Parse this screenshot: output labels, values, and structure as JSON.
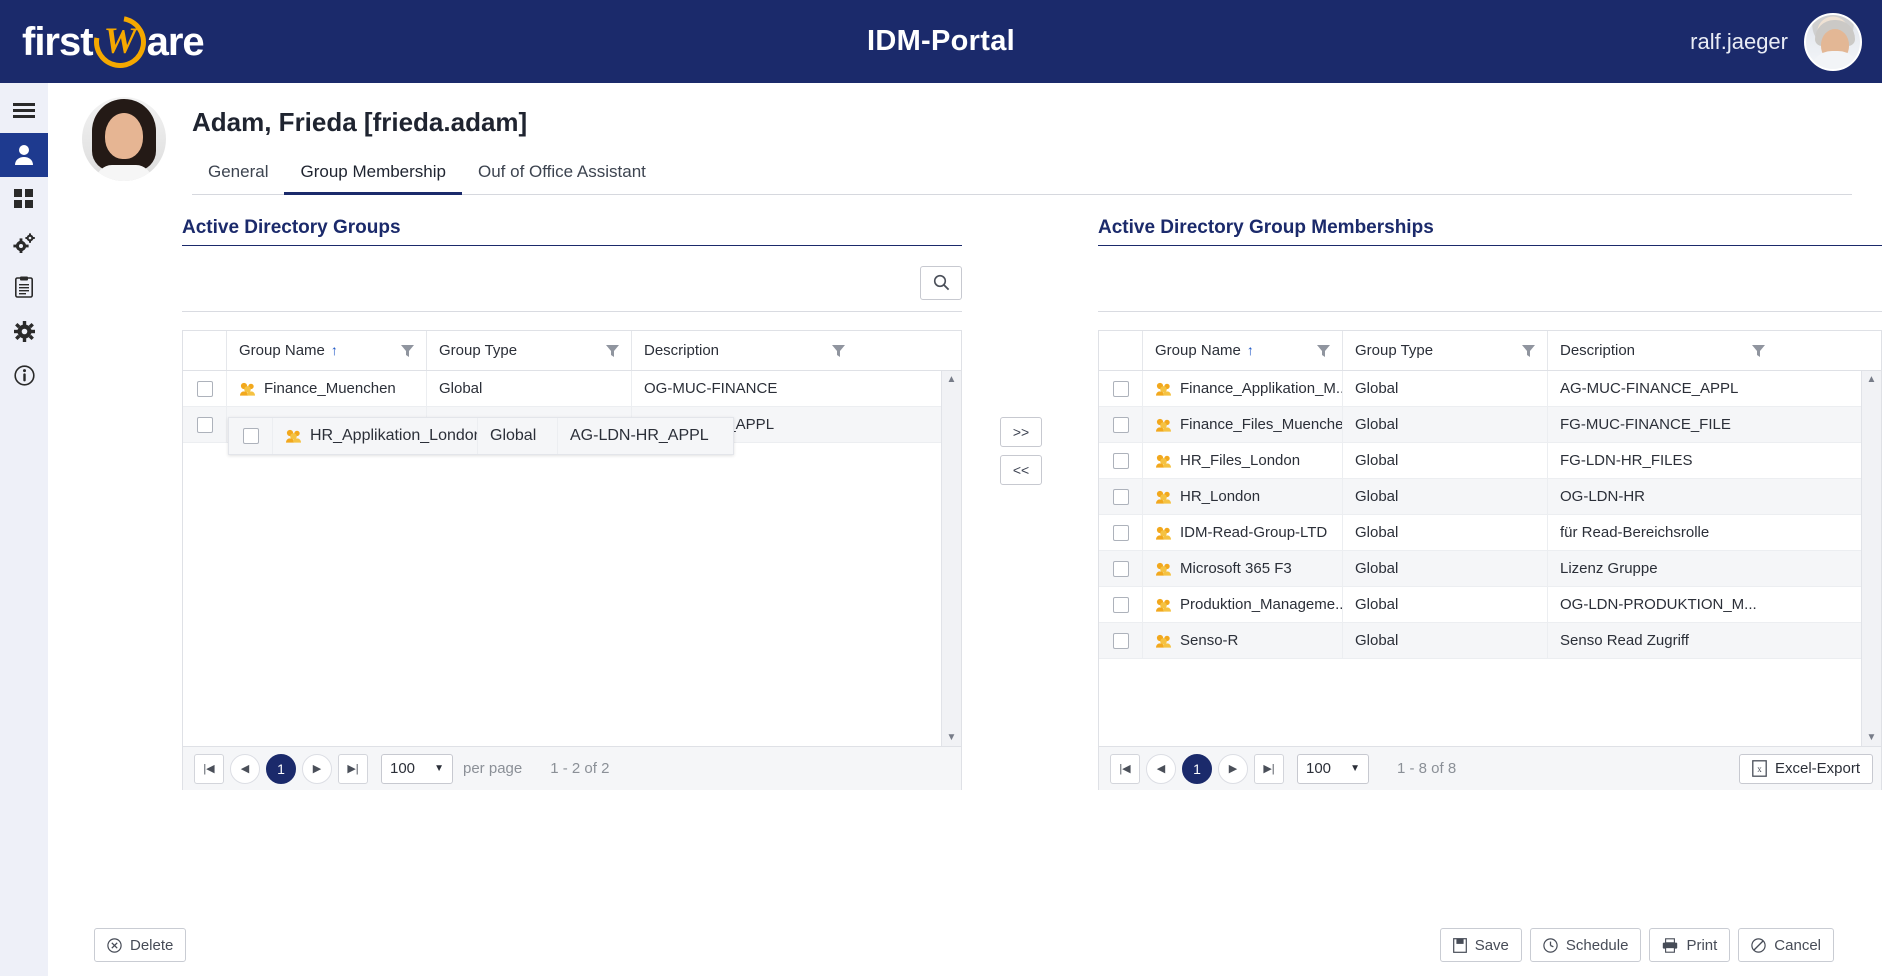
{
  "header": {
    "logo_text_1": "first",
    "logo_w": "W",
    "logo_text_2": "are",
    "app_title": "IDM-Portal",
    "user_name": "ralf.jaeger",
    "brand_blue": "#1b2a6b",
    "brand_orange": "#f5a800"
  },
  "sidebar": {
    "items": [
      {
        "name": "menu-icon",
        "label": "Menu"
      },
      {
        "name": "user-icon",
        "label": "Users"
      },
      {
        "name": "dashboard-grid-icon",
        "label": "Dashboard"
      },
      {
        "name": "gears-icon",
        "label": "Processes"
      },
      {
        "name": "clipboard-icon",
        "label": "Tasks"
      },
      {
        "name": "settings-gear-icon",
        "label": "Settings"
      },
      {
        "name": "info-icon",
        "label": "Info"
      }
    ],
    "active_index": 1
  },
  "profile": {
    "display_name": "Adam, Frieda [frieda.adam]",
    "avatar_alt": "Frieda Adam"
  },
  "tabs": [
    {
      "label": "General",
      "active": false
    },
    {
      "label": "Group Membership",
      "active": true
    },
    {
      "label": "Ouf of Office Assistant",
      "active": false
    }
  ],
  "left_panel": {
    "title": "Active Directory Groups",
    "search": {
      "value": "",
      "placeholder": "",
      "button_icon": "search-icon"
    },
    "columns": [
      "",
      "Group Name",
      "Group Type",
      "Description"
    ],
    "sort_column": "Group Name",
    "sort_direction": "ascending",
    "sort_glyph": "↑",
    "rows": [
      {
        "name": "Finance_Muenchen",
        "type": "Global",
        "description": "OG-MUC-FINANCE",
        "checked": false
      },
      {
        "name": "HR_Applikation_London",
        "type": "Global",
        "description": "AG-LDN-HR_APPL",
        "checked": false
      }
    ],
    "pager": {
      "first": "|◀",
      "prev": "◀",
      "page": "1",
      "next": "▶",
      "last": "▶|",
      "per_page_value": "100",
      "per_page_label": "per page",
      "range": "1 - 2 of 2"
    }
  },
  "drag_ghost": {
    "name": "HR_Applikation_London",
    "type": "Global",
    "description": "AG-LDN-HR_APPL"
  },
  "transfer": {
    "to_right": ">>",
    "to_left": "<<"
  },
  "right_panel": {
    "title": "Active Directory Group Memberships",
    "search": {
      "value": "",
      "placeholder": ""
    },
    "columns": [
      "",
      "Group Name",
      "Group Type",
      "Description"
    ],
    "sort_column": "Group Name",
    "sort_direction": "ascending",
    "sort_glyph": "↑",
    "rows": [
      {
        "name": "Finance_Applikation_M...",
        "type": "Global",
        "description": "AG-MUC-FINANCE_APPL",
        "checked": false
      },
      {
        "name": "Finance_Files_Muenchen",
        "type": "Global",
        "description": "FG-MUC-FINANCE_FILE",
        "checked": false
      },
      {
        "name": "HR_Files_London",
        "type": "Global",
        "description": "FG-LDN-HR_FILES",
        "checked": false
      },
      {
        "name": "HR_London",
        "type": "Global",
        "description": "OG-LDN-HR",
        "checked": false
      },
      {
        "name": "IDM-Read-Group-LTD",
        "type": "Global",
        "description": "für Read-Bereichsrolle",
        "checked": false
      },
      {
        "name": "Microsoft 365 F3",
        "type": "Global",
        "description": "Lizenz Gruppe",
        "checked": false
      },
      {
        "name": "Produktion_Manageme...",
        "type": "Global",
        "description": "OG-LDN-PRODUKTION_M...",
        "checked": false
      },
      {
        "name": "Senso-R",
        "type": "Global",
        "description": "Senso Read Zugriff",
        "checked": false
      }
    ],
    "pager": {
      "first": "|◀",
      "prev": "◀",
      "page": "1",
      "next": "▶",
      "last": "▶|",
      "per_page_value": "100",
      "range": "1 - 8 of 8",
      "excel_export": "Excel-Export"
    }
  },
  "footer": {
    "delete": "Delete",
    "save": "Save",
    "schedule": "Schedule",
    "print": "Print",
    "cancel": "Cancel"
  }
}
